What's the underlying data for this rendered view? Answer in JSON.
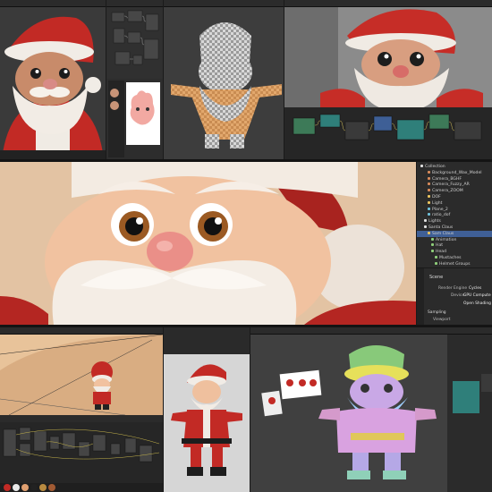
{
  "outliner": {
    "items": [
      "Collection",
      "Background_Wax_Model",
      "Camera_BGHF",
      "Camera_Fuzzy_AR",
      "Camera_ZOOM",
      "DOF",
      "Light",
      "Plane_2",
      "ratio_dof",
      "Lights",
      "Santa Claus",
      "Sam Claus",
      "Animation",
      "Hat",
      "Head",
      "Mustaches",
      "Helmet Groups"
    ]
  },
  "properties": {
    "section": "Scene",
    "render_engine_label": "Render Engine",
    "render_engine_value": "Cycles",
    "device_label": "Device",
    "device_value": "GPU Compute",
    "open_shading_label": "Open Shading",
    "sampling_label": "Sampling",
    "viewport_label": "Viewport"
  },
  "colors": {
    "app_bg": "#1d1d1d",
    "panel_header": "#2b2b2b",
    "node_body": "#3a3a3a",
    "node_green": "#3d7a58",
    "node_teal": "#2f7f7a",
    "node_blue": "#3e5f96",
    "node_purple": "#6b4f9a",
    "node_red": "#a33a34",
    "santa_red": "#c22a25",
    "skin": "#f1c2a0",
    "beard": "#f3ece4",
    "selected": "#3f5f96"
  }
}
